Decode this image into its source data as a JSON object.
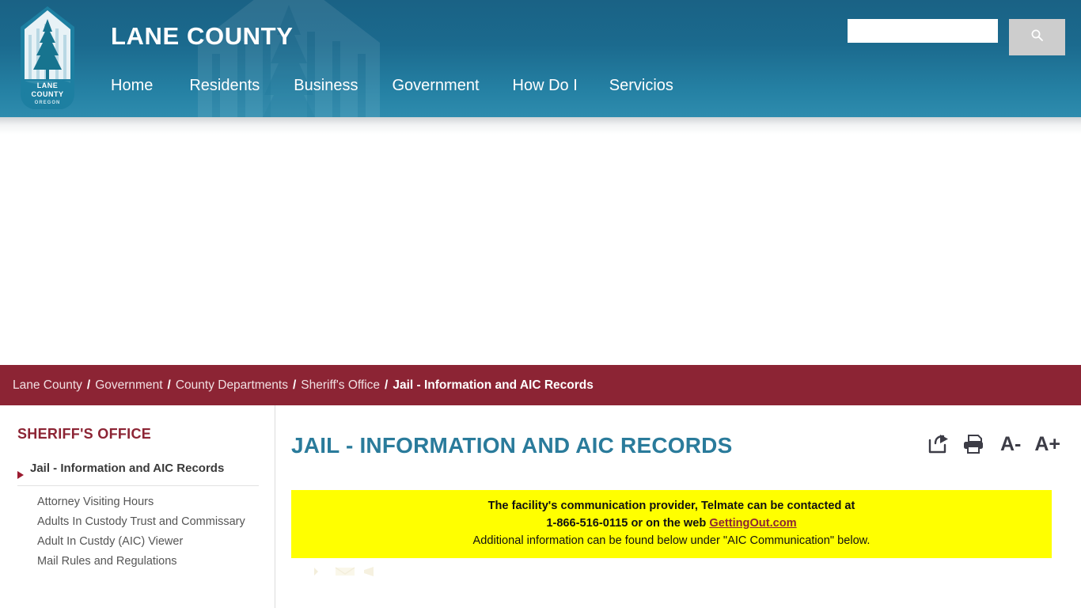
{
  "header": {
    "site_title": "LANE COUNTY",
    "logo_alt": "Lane County Oregon seal",
    "logo_text_line1": "LANE",
    "logo_text_line2": "COUNTY",
    "logo_text_line3": "OREGON",
    "nav": [
      {
        "label": "Home",
        "name": "nav-home"
      },
      {
        "label": "Residents",
        "name": "nav-residents"
      },
      {
        "label": "Business",
        "name": "nav-business"
      },
      {
        "label": "Government",
        "name": "nav-government"
      },
      {
        "label": "How Do I",
        "name": "nav-how-do-i"
      },
      {
        "label": "Servicios",
        "name": "nav-servicios"
      }
    ],
    "search": {
      "value": "",
      "placeholder": "",
      "button_icon": "search-icon"
    }
  },
  "breadcrumb": {
    "separator": "/",
    "items": [
      {
        "label": "Lane County"
      },
      {
        "label": "Government"
      },
      {
        "label": "County Departments"
      },
      {
        "label": "Sheriff's Office"
      }
    ],
    "current": "Jail - Information and AIC Records"
  },
  "sidebar": {
    "title": "SHERIFF'S OFFICE",
    "active_item": "Jail - Information and AIC Records",
    "items": [
      {
        "label": "Attorney Visiting Hours"
      },
      {
        "label": "Adults In Custody Trust and Commissary"
      },
      {
        "label": "Adult In Custdy (AIC) Viewer"
      },
      {
        "label": "Mail Rules and Regulations"
      }
    ]
  },
  "content": {
    "page_title": "JAIL - INFORMATION AND AIC RECORDS",
    "tools": [
      {
        "name": "share-icon",
        "label": ""
      },
      {
        "name": "print-icon",
        "label": ""
      },
      {
        "name": "decrease-text-size-button",
        "label": "A-"
      },
      {
        "name": "increase-text-size-button",
        "label": "A+"
      }
    ],
    "alert": {
      "line1": "The facility's communication provider, Telmate can be contacted at",
      "line2_prefix": "1-866-516-0115 or on the web ",
      "line2_link": "GettingOut.com",
      "line3": "Additional information can be found below under \"AIC Communication\" below.",
      "background_color": "#ffff00"
    }
  },
  "colors": {
    "header_top": "#1a6285",
    "header_bottom": "#2e8cae",
    "breadcrumb_bar": "#8c2434",
    "sidebar_heading": "#8c2434",
    "page_title": "#2a7b9b",
    "alert_link": "#8c2434"
  }
}
